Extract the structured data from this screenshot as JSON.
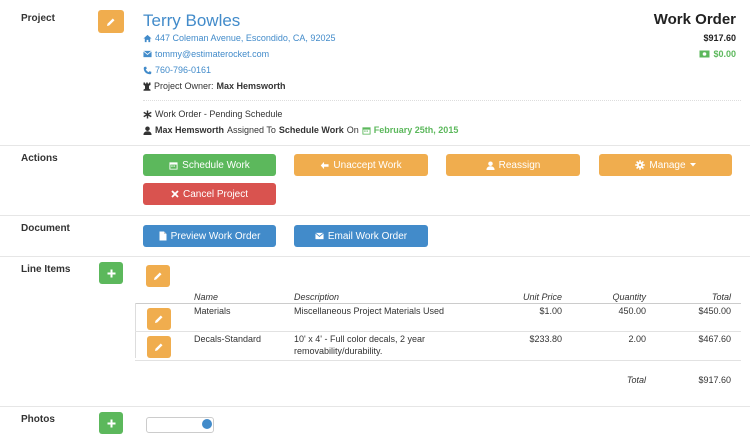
{
  "project": {
    "section_label": "Project",
    "client_name": "Terry Bowles",
    "address": "447 Coleman Avenue, Escondido, CA, 92025",
    "email": "tommy@estimaterocket.com",
    "phone": "760-796-0161",
    "owner_label": "Project Owner:",
    "owner_name": "Max Hemsworth",
    "status": "Work Order - Pending Schedule",
    "assign_from": "Max Hemsworth",
    "assign_text": "Assigned To",
    "assign_stage": "Schedule Work",
    "assign_on": "On",
    "assign_date": "February 25th, 2015"
  },
  "header": {
    "doc_type": "Work Order",
    "total": "$917.60",
    "paid": "$0.00"
  },
  "actions": {
    "section_label": "Actions",
    "schedule_label": "Schedule Work",
    "unaccept_label": "Unaccept Work",
    "reassign_label": "Reassign",
    "manage_label": "Manage",
    "cancel_label": "Cancel Project"
  },
  "document": {
    "section_label": "Document",
    "preview_label": "Preview Work Order",
    "email_label": "Email Work Order"
  },
  "line_items": {
    "section_label": "Line Items",
    "columns": {
      "name": "Name",
      "description": "Description",
      "unit_price": "Unit Price",
      "quantity": "Quantity",
      "total": "Total"
    },
    "rows": [
      {
        "name": "Materials",
        "description": "Miscellaneous Project Materials Used",
        "unit_price": "$1.00",
        "quantity": "450.00",
        "total": "$450.00"
      },
      {
        "name": "Decals-Standard",
        "description_line1": "10' x 4' - Full color decals, 2 year",
        "description_line2": "removability/durability.",
        "unit_price": "$233.80",
        "quantity": "2.00",
        "total": "$467.60"
      }
    ],
    "total_label": "Total",
    "total_value": "$917.60"
  },
  "photos": {
    "section_label": "Photos"
  },
  "colors": {
    "primary": "#428bca",
    "success": "#5cb85c",
    "warning": "#f0ad4e",
    "danger": "#d9534f"
  }
}
